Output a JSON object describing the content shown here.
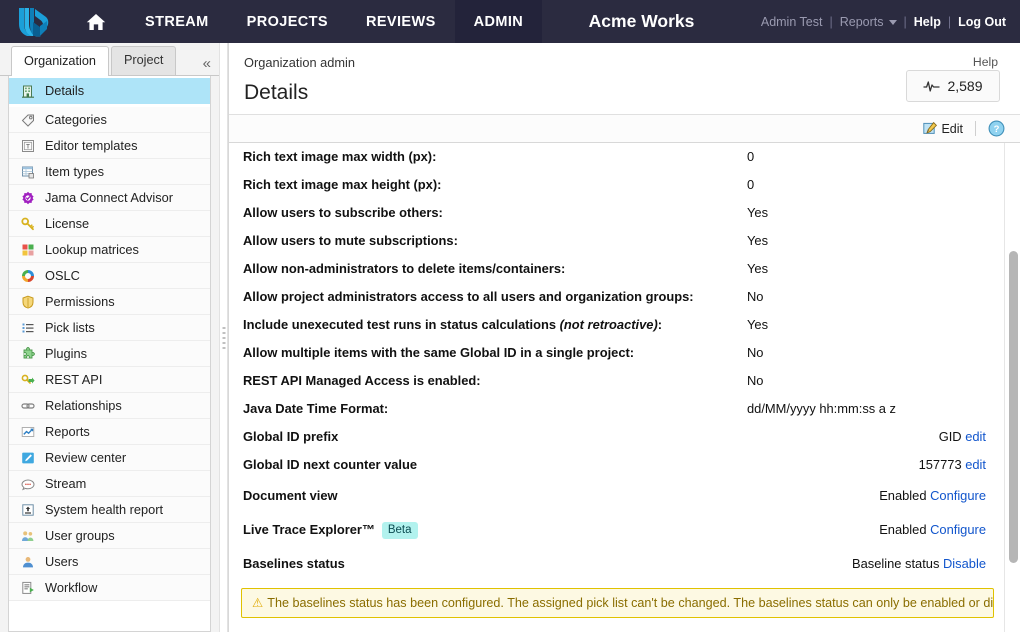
{
  "topnav": {
    "logo_icon": "jama-logo-icon",
    "home_icon": "home-icon",
    "items": [
      {
        "label": "STREAM",
        "active": false
      },
      {
        "label": "PROJECTS",
        "active": false
      },
      {
        "label": "REVIEWS",
        "active": false
      },
      {
        "label": "ADMIN",
        "active": true
      }
    ],
    "brand": "Acme Works",
    "user": {
      "name": "Admin Test",
      "reports_label": "Reports",
      "reports_caret_icon": "chevron-down-icon",
      "help_label": "Help",
      "logout_label": "Log Out",
      "separator": "|"
    }
  },
  "sidebar": {
    "tabs": [
      {
        "label": "Organization",
        "active": true
      },
      {
        "label": "Project",
        "active": false
      }
    ],
    "collapse_icon": "double-chevron-left-icon",
    "items": [
      {
        "label": "Details",
        "icon": "building-icon",
        "selected": true
      },
      {
        "label": "Categories",
        "icon": "tag-icon",
        "selected": false
      },
      {
        "label": "Editor templates",
        "icon": "template-icon",
        "selected": false
      },
      {
        "label": "Item types",
        "icon": "grid-table-icon",
        "selected": false
      },
      {
        "label": "Jama Connect Advisor",
        "icon": "advisor-badge-icon",
        "selected": false
      },
      {
        "label": "License",
        "icon": "key-icon",
        "selected": false
      },
      {
        "label": "Lookup matrices",
        "icon": "matrix-icon",
        "selected": false
      },
      {
        "label": "OSLC",
        "icon": "oslc-ring-icon",
        "selected": false
      },
      {
        "label": "Permissions",
        "icon": "shield-icon",
        "selected": false
      },
      {
        "label": "Pick lists",
        "icon": "list-icon",
        "selected": false
      },
      {
        "label": "Plugins",
        "icon": "puzzle-icon",
        "selected": false
      },
      {
        "label": "REST API",
        "icon": "rest-api-icon",
        "selected": false
      },
      {
        "label": "Relationships",
        "icon": "chain-link-icon",
        "selected": false
      },
      {
        "label": "Reports",
        "icon": "chart-line-icon",
        "selected": false
      },
      {
        "label": "Review center",
        "icon": "pencil-review-icon",
        "selected": false
      },
      {
        "label": "Stream",
        "icon": "speech-bubble-icon",
        "selected": false
      },
      {
        "label": "System health report",
        "icon": "health-report-icon",
        "selected": false
      },
      {
        "label": "User groups",
        "icon": "user-group-icon",
        "selected": false
      },
      {
        "label": "Users",
        "icon": "user-icon",
        "selected": false
      },
      {
        "label": "Workflow",
        "icon": "workflow-icon",
        "selected": false
      }
    ]
  },
  "main": {
    "breadcrumb": "Organization admin",
    "help_link": "Help",
    "title": "Details",
    "metric": {
      "icon": "activity-pulse-icon",
      "value": "2,589"
    },
    "toolbar": {
      "edit_label": "Edit",
      "edit_icon": "edit-pencil-icon",
      "help_icon": "help-circle-icon"
    },
    "rows": [
      {
        "label": "Rich text image max width (px):",
        "value": "0",
        "align": "left"
      },
      {
        "label": "Rich text image max height (px):",
        "value": "0",
        "align": "left"
      },
      {
        "label": "Allow users to subscribe others:",
        "value": "Yes",
        "align": "left"
      },
      {
        "label": "Allow users to mute subscriptions:",
        "value": "Yes",
        "align": "left"
      },
      {
        "label": "Allow non-administrators to delete items/containers:",
        "value": "Yes",
        "align": "left"
      },
      {
        "label": "Allow project administrators access to all users and organization groups:",
        "value": "No",
        "align": "left"
      },
      {
        "label": "Include unexecuted test runs in status calculations",
        "label_italic": "(not retroactive)",
        "label_suffix": ":",
        "value": "Yes",
        "align": "left"
      },
      {
        "label": "Allow multiple items with the same Global ID in a single project:",
        "value": "No",
        "align": "left"
      },
      {
        "label": "REST API Managed Access is enabled:",
        "value": "No",
        "align": "left"
      },
      {
        "label": "Java Date Time Format:",
        "value": "dd/MM/yyyy hh:mm:ss a z",
        "align": "left"
      },
      {
        "label": "Global ID prefix",
        "value": "GID",
        "link": "edit",
        "align": "right"
      },
      {
        "label": "Global ID next counter value",
        "value": "157773",
        "link": "edit",
        "align": "right"
      },
      {
        "label": "Document view",
        "value": "Enabled",
        "link": "Configure",
        "align": "right",
        "tall": true
      },
      {
        "label": "Live Trace Explorer™",
        "badge": "Beta",
        "value": "Enabled",
        "link": "Configure",
        "align": "right",
        "tall": true
      },
      {
        "label": "Baselines status",
        "value": "Baseline status",
        "link": "Disable",
        "align": "right",
        "tall": true
      }
    ],
    "warning": {
      "icon": "warning-triangle-icon",
      "text": "The baselines status has been configured. The assigned pick list can't be changed. The baselines status can only be enabled or disabled"
    },
    "scrollbar": "vertical-scrollbar"
  }
}
